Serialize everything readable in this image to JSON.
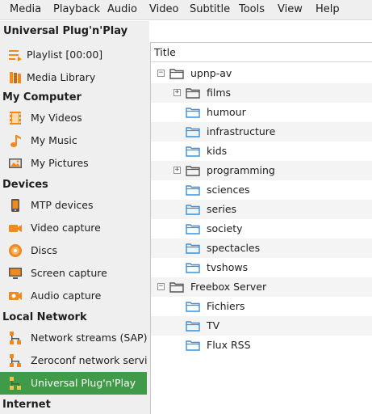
{
  "menubar": {
    "items": [
      "Media",
      "Playback",
      "Audio",
      "Video",
      "Subtitle",
      "Tools",
      "View",
      "Help"
    ]
  },
  "sidebar": {
    "panel_title": "Universal Plug'n'Play",
    "items": [
      {
        "label": "Playlist [00:00]",
        "icon": "playlist-icon"
      },
      {
        "label": "Media Library",
        "icon": "media-library-icon"
      }
    ],
    "my_computer": {
      "header": "My Computer",
      "items": [
        {
          "label": "My Videos",
          "icon": "film-icon"
        },
        {
          "label": "My Music",
          "icon": "music-note-icon"
        },
        {
          "label": "My Pictures",
          "icon": "picture-icon"
        }
      ]
    },
    "devices": {
      "header": "Devices",
      "items": [
        {
          "label": "MTP devices",
          "icon": "mtp-device-icon"
        },
        {
          "label": "Video capture",
          "icon": "video-capture-icon"
        },
        {
          "label": "Discs",
          "icon": "disc-icon"
        },
        {
          "label": "Screen capture",
          "icon": "screen-capture-icon"
        },
        {
          "label": "Audio capture",
          "icon": "audio-capture-icon"
        }
      ]
    },
    "local_network": {
      "header": "Local Network",
      "items": [
        {
          "label": "Network streams (SAP)",
          "icon": "network-icon"
        },
        {
          "label": "Zeroconf network servi...",
          "icon": "network-icon"
        },
        {
          "label": "Universal Plug'n'Play",
          "icon": "network-icon",
          "selected": true
        }
      ]
    },
    "internet": {
      "header": "Internet"
    }
  },
  "tree": {
    "column_title": "Title",
    "nodes": [
      {
        "label": "upnp-av",
        "level": 0,
        "expander": "−"
      },
      {
        "label": "films",
        "level": 1,
        "expander": "+"
      },
      {
        "label": "humour",
        "level": 1,
        "expander": ""
      },
      {
        "label": "infrastructure",
        "level": 1,
        "expander": ""
      },
      {
        "label": "kids",
        "level": 1,
        "expander": ""
      },
      {
        "label": "programming",
        "level": 1,
        "expander": "+"
      },
      {
        "label": "sciences",
        "level": 1,
        "expander": ""
      },
      {
        "label": "series",
        "level": 1,
        "expander": ""
      },
      {
        "label": "society",
        "level": 1,
        "expander": ""
      },
      {
        "label": "spectacles",
        "level": 1,
        "expander": ""
      },
      {
        "label": "tvshows",
        "level": 1,
        "expander": ""
      },
      {
        "label": "Freebox Server",
        "level": 0,
        "expander": "−"
      },
      {
        "label": "Fichiers",
        "level": 1,
        "expander": ""
      },
      {
        "label": "TV",
        "level": 1,
        "expander": ""
      },
      {
        "label": "Flux RSS",
        "level": 1,
        "expander": ""
      }
    ]
  },
  "colors": {
    "selection": "#3f9b48",
    "folder_blue": "#3d8fd6",
    "folder_gray": "#555555",
    "icon_orange": "#f08a1c"
  }
}
